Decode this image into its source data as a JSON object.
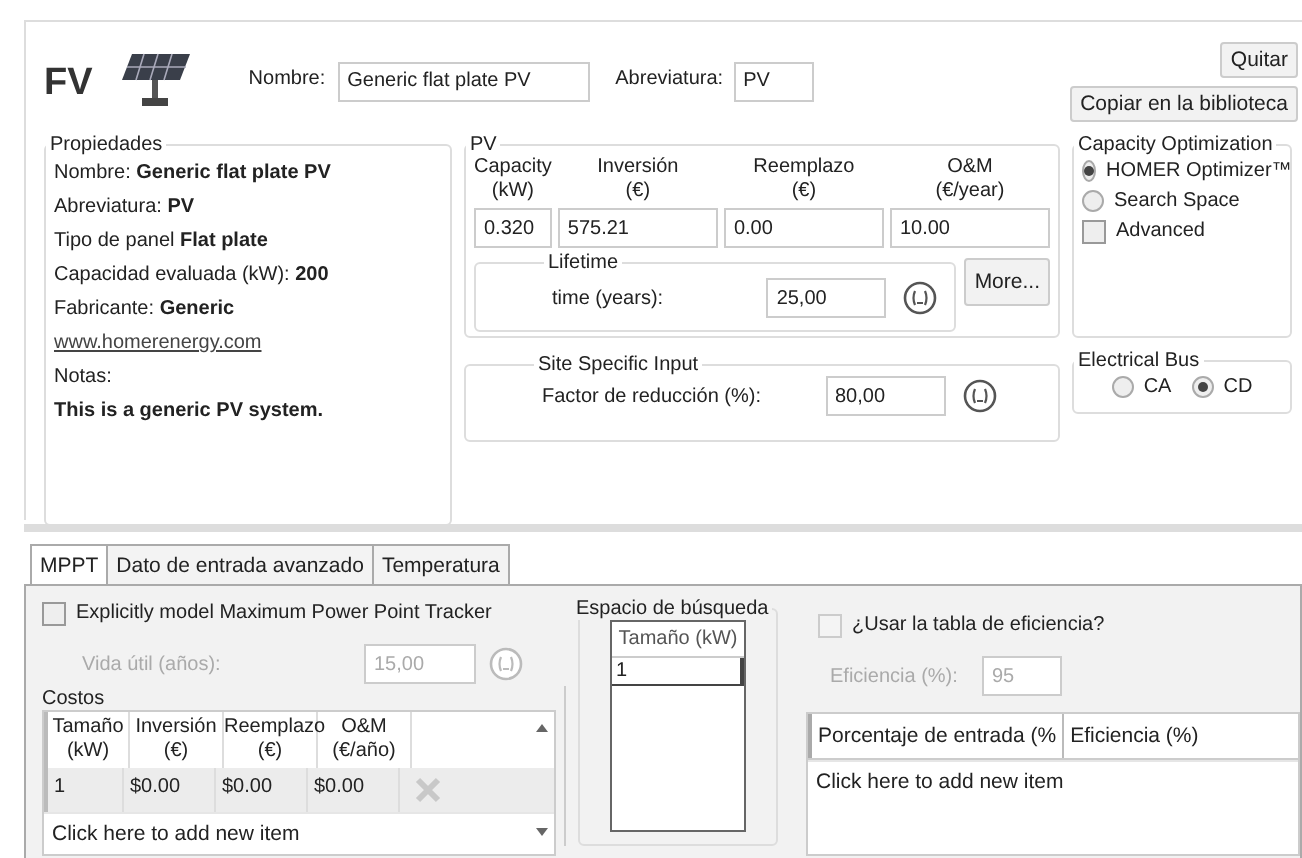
{
  "header": {
    "title": "FV",
    "name_label": "Nombre:",
    "name_value": "Generic flat plate PV",
    "abbr_label": "Abreviatura:",
    "abbr_value": "PV",
    "buttons": [
      "Quitar",
      "Copiar en la biblioteca"
    ]
  },
  "properties": {
    "legend": "Propiedades",
    "lines": [
      {
        "label": "Nombre:",
        "value": "Generic flat plate PV"
      },
      {
        "label": "Abreviatura:",
        "value": "PV"
      },
      {
        "label": "Tipo de panel",
        "value": "Flat plate"
      },
      {
        "label": "Capacidad evaluada (kW):",
        "value": "200"
      },
      {
        "label": "Fabricante:",
        "value": "Generic"
      }
    ],
    "link": "www.homerenergy.com",
    "notes_label": "Notas:",
    "notes": "This is a generic PV system."
  },
  "pv": {
    "legend": "PV",
    "columns": [
      {
        "header": "Capacity",
        "unit": "(kW)",
        "value": "0.320"
      },
      {
        "header": "Inversión",
        "unit": "(€)",
        "value": "575.21"
      },
      {
        "header": "Reemplazo",
        "unit": "(€)",
        "value": "0.00"
      },
      {
        "header": "O&M",
        "unit": "(€/year)",
        "value": "10.00"
      }
    ],
    "lifetime": {
      "legend": "Lifetime",
      "label": "time (years):",
      "value": "25,00"
    },
    "more_button": "More..."
  },
  "capacity_optimization": {
    "legend": "Capacity Optimization",
    "options": [
      {
        "label": "HOMER Optimizer™",
        "selected": true
      },
      {
        "label": "Search Space",
        "selected": false
      }
    ],
    "advanced": {
      "label": "Advanced",
      "checked": false
    }
  },
  "site_input": {
    "legend": "Site Specific Input",
    "label": "Factor de reducción (%):",
    "value": "80,00"
  },
  "electrical_bus": {
    "legend": "Electrical Bus",
    "options": [
      {
        "label": "CA",
        "selected": false
      },
      {
        "label": "CD",
        "selected": true
      }
    ]
  },
  "tabs": [
    {
      "label": "MPPT",
      "selected": true
    },
    {
      "label": "Dato de entrada avanzado",
      "selected": false
    },
    {
      "label": "Temperatura",
      "selected": false
    }
  ],
  "mppt": {
    "checkbox": {
      "label": "Explicitly model Maximum Power Point Tracker",
      "checked": false
    },
    "lifetime_label": "Vida útil (años):",
    "lifetime_value": "15,00",
    "disabled": true,
    "costs": {
      "legend": "Costos",
      "columns": [
        {
          "header": "Tamaño",
          "unit": "(kW)"
        },
        {
          "header": "Inversión",
          "unit": "(€)"
        },
        {
          "header": "Reemplazo",
          "unit": "(€)"
        },
        {
          "header": "O&M",
          "unit": "(€/año)"
        }
      ],
      "rows": [
        [
          "1",
          "$0.00",
          "$0.00",
          "$0.00"
        ]
      ],
      "add_row": "Click here to add new item"
    }
  },
  "search_space": {
    "legend": "Espacio de búsqueda",
    "column": "Tamaño (kW)",
    "values": [
      "1"
    ]
  },
  "efficiency": {
    "checkbox": {
      "label": "¿Usar la tabla de eficiencia?",
      "checked": false
    },
    "label": "Eficiencia (%):",
    "value": "95",
    "disabled": true,
    "columns": [
      "Porcentaje de entrada (%",
      "Eficiencia (%)"
    ],
    "add_row": "Click here to add new item"
  }
}
